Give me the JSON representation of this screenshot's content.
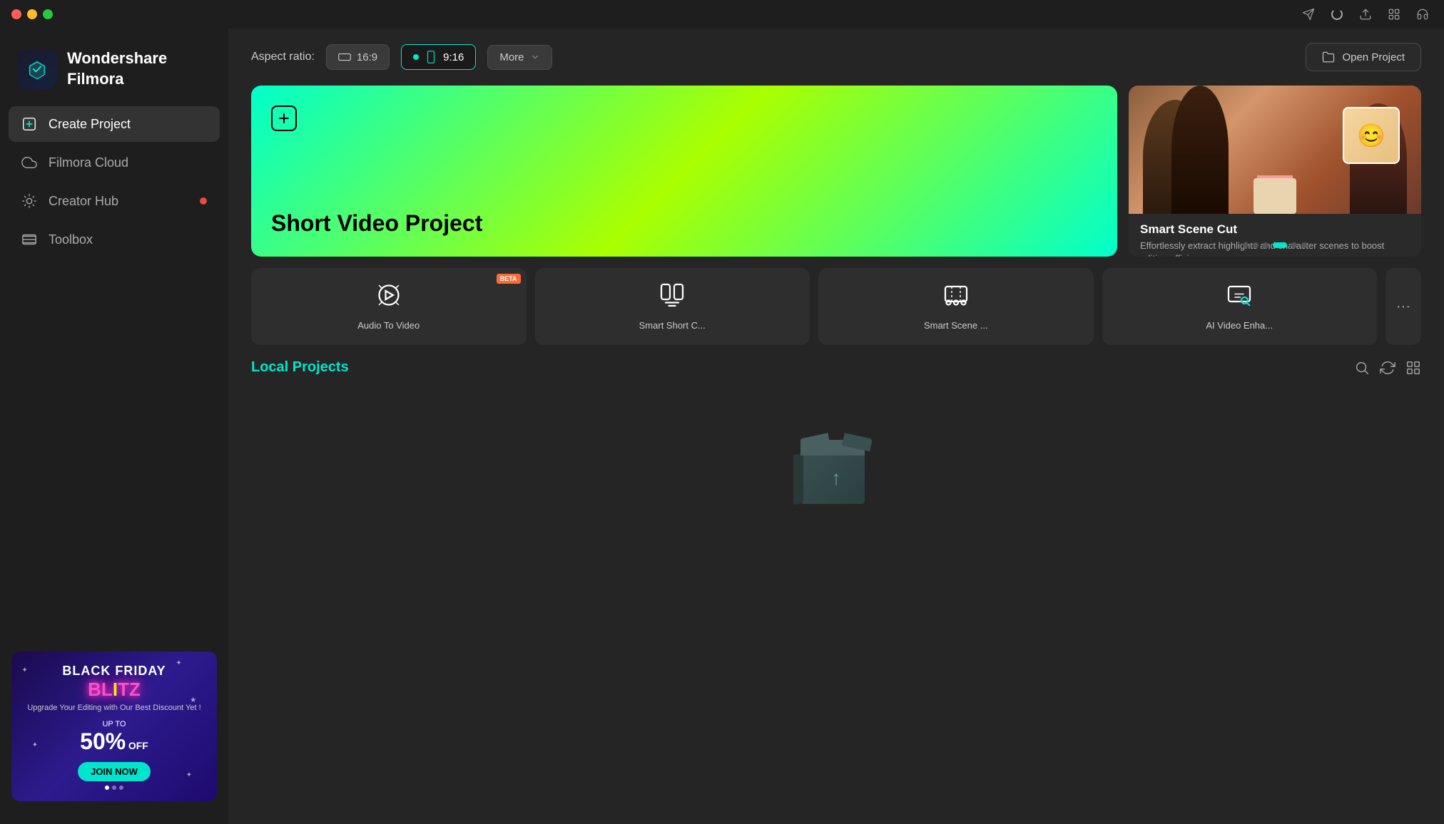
{
  "window": {
    "title": "Wondershare Filmora"
  },
  "titlebar": {
    "icons": [
      "send-icon",
      "spinner-icon",
      "upload-icon",
      "grid-icon",
      "headphone-icon"
    ]
  },
  "sidebar": {
    "logo": {
      "name": "Wondershare Filmora",
      "line1": "Wondershare",
      "line2": "Filmora"
    },
    "nav": [
      {
        "id": "create-project",
        "label": "Create Project",
        "active": true
      },
      {
        "id": "filmora-cloud",
        "label": "Filmora Cloud",
        "active": false
      },
      {
        "id": "creator-hub",
        "label": "Creator Hub",
        "active": false,
        "badge": true
      },
      {
        "id": "toolbox",
        "label": "Toolbox",
        "active": false
      }
    ],
    "ad": {
      "line1": "BLACK FRIDAY",
      "line2": "BL TZ",
      "line2_highlight": "I",
      "desc": "Upgrade Your Editing with Our Best Discount Yet !",
      "discount": "50%",
      "discount_prefix": "UP TO",
      "discount_suffix": "OFF",
      "button_label": "JOIN NOW",
      "dots": [
        true,
        true,
        false
      ]
    }
  },
  "main": {
    "aspect_ratio": {
      "label": "Aspect ratio:",
      "options": [
        {
          "id": "16-9",
          "label": "16:9",
          "active": false
        },
        {
          "id": "9-16",
          "label": "9:16",
          "active": true
        }
      ],
      "more_label": "More",
      "open_project_label": "Open Project"
    },
    "hero": {
      "title": "Short Video Project",
      "plus_icon": true
    },
    "side_panel": {
      "title": "Smart Scene Cut",
      "description": "Effortlessly extract highlights and character scenes to boost editing efficien…",
      "dots": [
        false,
        false,
        false,
        true,
        false,
        false
      ]
    },
    "tools": [
      {
        "id": "audio-to-video",
        "label": "Audio To Video",
        "beta": true
      },
      {
        "id": "smart-short-cut",
        "label": "Smart Short C...",
        "beta": false
      },
      {
        "id": "smart-scene-cut",
        "label": "Smart Scene ...",
        "beta": false
      },
      {
        "id": "ai-video-enhance",
        "label": "AI Video Enha...",
        "beta": false
      }
    ],
    "more_tools_icon": "···",
    "local_projects": {
      "title": "Local Projects",
      "empty_state": true
    }
  }
}
